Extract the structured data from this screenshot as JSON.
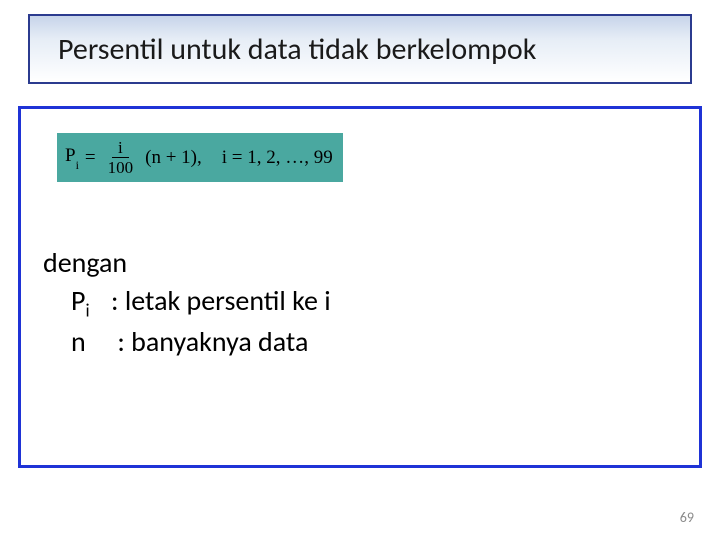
{
  "title": "Persentil untuk data tidak berkelompok",
  "formula": {
    "lhs_base": "P",
    "lhs_sub": "i",
    "eq": "=",
    "frac_num": "i",
    "frac_den": "100",
    "tail": "(n + 1),",
    "range": "i = 1, 2, …, 99"
  },
  "defs": {
    "lead": "dengan",
    "p_sym_base": "P",
    "p_sym_sub": "i",
    "p_desc": ": letak persentil ke i",
    "n_sym": "n",
    "n_desc": ": banyaknya data"
  },
  "page": "69"
}
